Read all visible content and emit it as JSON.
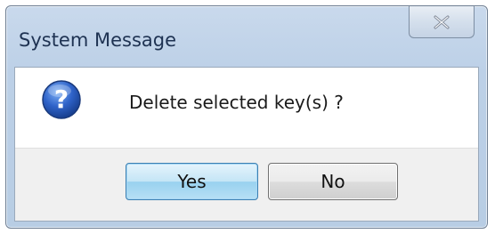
{
  "window": {
    "title": "System Message"
  },
  "titlebar": {
    "close_icon": "close-icon"
  },
  "message": {
    "icon": "question-icon",
    "text": "Delete selected key(s) ?"
  },
  "buttons": {
    "yes_label": "Yes",
    "no_label": "No"
  },
  "colors": {
    "accent_button_border": "#3c7fb1",
    "question_icon_blue": "#2f63c9"
  }
}
